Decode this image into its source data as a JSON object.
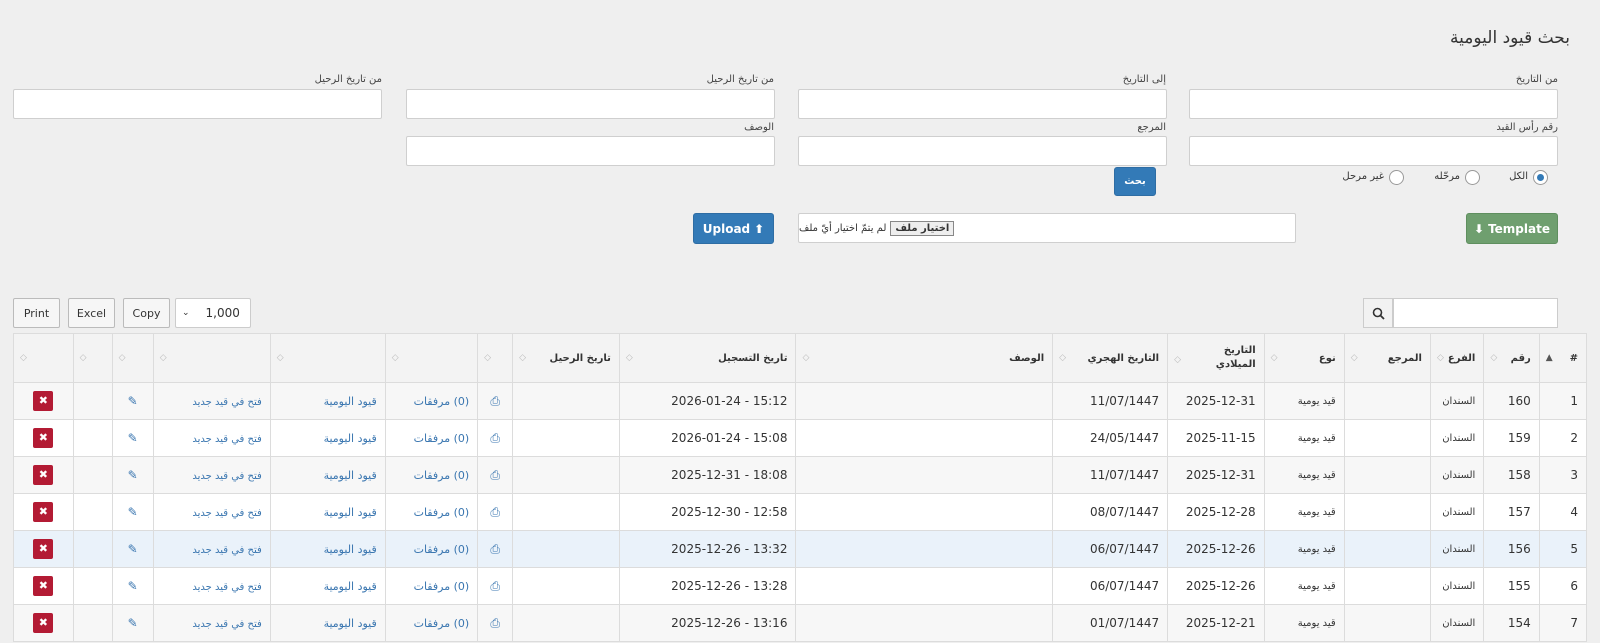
{
  "page": {
    "title": "بحث قيود اليومية"
  },
  "form": {
    "from_date_label": "من التاريخ",
    "to_date_label": "إلى التاريخ",
    "trip_from_label": "من تاريخ الرحيل",
    "trip_to_label": "من تاريخ الرحيل",
    "head_no_label": "رقم رأس القيد",
    "reference_label": "المرجع",
    "description_label": "الوصف",
    "search_button": "بحث",
    "radios": [
      {
        "label": "الكل",
        "checked": true
      },
      {
        "label": "مرحّله",
        "checked": false
      },
      {
        "label": "غير مرحل",
        "checked": false
      }
    ]
  },
  "upload": {
    "template_button": "Template",
    "file_choose_button": "اختيار ملف",
    "file_status": "لم يتمّ اختيار أيّ ملف",
    "upload_button": "Upload"
  },
  "toolbar": {
    "print": "Print",
    "excel": "Excel",
    "copy": "Copy",
    "page_size": "1,000",
    "search_value": ""
  },
  "table": {
    "headers": {
      "idx": "#",
      "no": "رقم",
      "branch": "الفرع",
      "reference": "المرجع",
      "type": "نوع",
      "greg_line1": "التاريخ",
      "greg_line2": "الميلادي",
      "hijri": "التاريخ الهجري",
      "description": "الوصف",
      "reg_date": "تاريخ التسجيل",
      "trip_date": "تاريخ الرحيل"
    },
    "attachments_label": "(0) مرفقات",
    "journal_label": "قيود اليومية",
    "open_new_label": "فتح في قيد جديد",
    "rows": [
      {
        "idx": "1",
        "no": "160",
        "branch": "السندان",
        "type": "قيد يومية",
        "greg": "2025-12-31",
        "hijri": "11/07/1447",
        "reg": "2026-01-24 - 15:12"
      },
      {
        "idx": "2",
        "no": "159",
        "branch": "السندان",
        "type": "قيد يومية",
        "greg": "2025-11-15",
        "hijri": "24/05/1447",
        "reg": "2026-01-24 - 15:08"
      },
      {
        "idx": "3",
        "no": "158",
        "branch": "السندان",
        "type": "قيد يومية",
        "greg": "2025-12-31",
        "hijri": "11/07/1447",
        "reg": "2025-12-31 - 18:08"
      },
      {
        "idx": "4",
        "no": "157",
        "branch": "السندان",
        "type": "قيد يومية",
        "greg": "2025-12-28",
        "hijri": "08/07/1447",
        "reg": "2025-12-30 - 12:58"
      },
      {
        "idx": "5",
        "no": "156",
        "branch": "السندان",
        "type": "قيد يومية",
        "greg": "2025-12-26",
        "hijri": "06/07/1447",
        "reg": "2025-12-26 - 13:32"
      },
      {
        "idx": "6",
        "no": "155",
        "branch": "السندان",
        "type": "قيد يومية",
        "greg": "2025-12-26",
        "hijri": "06/07/1447",
        "reg": "2025-12-26 - 13:28"
      },
      {
        "idx": "7",
        "no": "154",
        "branch": "السندان",
        "type": "قيد يومية",
        "greg": "2025-12-21",
        "hijri": "01/07/1447",
        "reg": "2025-12-26 - 13:16"
      }
    ]
  }
}
